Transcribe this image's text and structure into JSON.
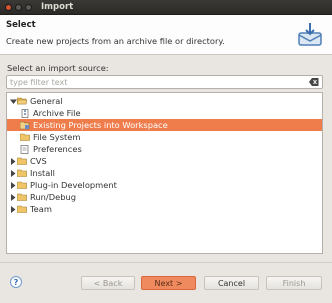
{
  "window": {
    "title": "Import"
  },
  "banner": {
    "heading": "Select",
    "description": "Create new projects from an archive file or directory."
  },
  "filter": {
    "label": "Select an import source:",
    "placeholder": "type filter text"
  },
  "tree": {
    "items": [
      {
        "label": "General",
        "expanded": true,
        "level": 0,
        "icon": "folder-open-icon"
      },
      {
        "label": "Archive File",
        "level": 1,
        "icon": "archive-file-icon"
      },
      {
        "label": "Existing Projects into Workspace",
        "level": 1,
        "selected": true,
        "icon": "project-icon"
      },
      {
        "label": "File System",
        "level": 1,
        "icon": "folder-icon"
      },
      {
        "label": "Preferences",
        "level": 1,
        "icon": "preferences-icon"
      },
      {
        "label": "CVS",
        "expanded": false,
        "level": 0,
        "icon": "folder-icon"
      },
      {
        "label": "Install",
        "expanded": false,
        "level": 0,
        "icon": "folder-icon"
      },
      {
        "label": "Plug-in Development",
        "expanded": false,
        "level": 0,
        "icon": "folder-icon"
      },
      {
        "label": "Run/Debug",
        "expanded": false,
        "level": 0,
        "icon": "folder-icon"
      },
      {
        "label": "Team",
        "expanded": false,
        "level": 0,
        "icon": "folder-icon"
      }
    ]
  },
  "buttons": {
    "back": "< Back",
    "next": "Next >",
    "cancel": "Cancel",
    "finish": "Finish",
    "help": "?"
  },
  "colors": {
    "selection": "#ef7d4c",
    "next_button": "#ef8a5e",
    "titlebar": "#2f2e2b"
  }
}
